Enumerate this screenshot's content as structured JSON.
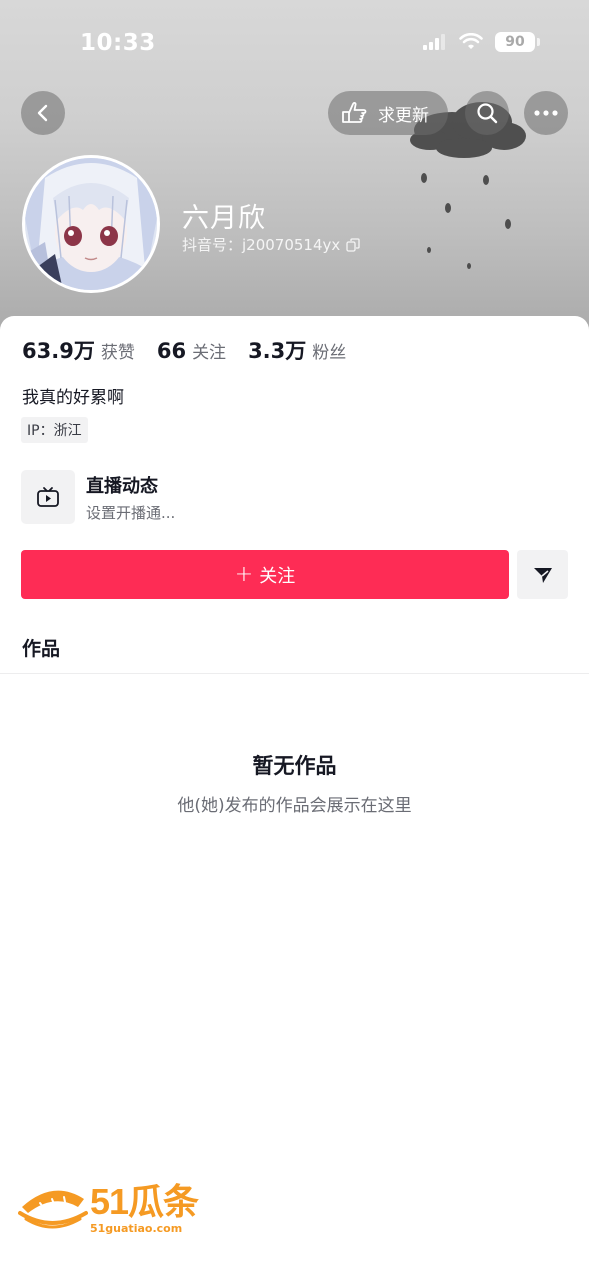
{
  "status_bar": {
    "time": "10:33",
    "battery": "90"
  },
  "header": {
    "update_label": "求更新"
  },
  "profile": {
    "nickname": "六月欣",
    "douyin_id": "抖音号：j20070514yx",
    "stats": [
      {
        "value": "63.9万",
        "label": "获赞"
      },
      {
        "value": "66",
        "label": "关注"
      },
      {
        "value": "3.3万",
        "label": "粉丝"
      }
    ],
    "bio": "我真的好累啊",
    "ip": "IP：浙江"
  },
  "live": {
    "title": "直播动态",
    "subtitle": "设置开播通..."
  },
  "actions": {
    "follow_label": "关注",
    "follow_plus": "+"
  },
  "tabs": {
    "works_label": "作品"
  },
  "empty_state": {
    "title": "暂无作品",
    "subtitle": "他(她)发布的作品会展示在这里"
  },
  "watermark": {
    "brand": "51瓜条",
    "url": "51guatiao.com"
  },
  "colors": {
    "accent": "#fe2c55",
    "text_primary": "#161823",
    "text_secondary": "#6b6d75",
    "watermark": "#f59a23"
  }
}
